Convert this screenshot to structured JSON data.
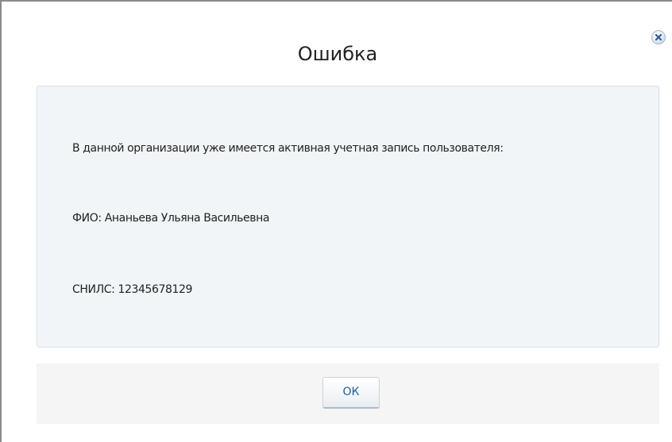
{
  "dialog": {
    "title": "Ошибка",
    "close_icon": "close-icon"
  },
  "message": {
    "line1": "В данной организации уже имеется активная учетная запись пользователя:",
    "line2": "ФИО: Ананьева Ульяна Васильевна",
    "line3": "СНИЛС: 12345678129"
  },
  "footer": {
    "ok_label": "ОК"
  },
  "colors": {
    "panel_background": "#f1f5f7",
    "button_text": "#1e5c9e"
  }
}
